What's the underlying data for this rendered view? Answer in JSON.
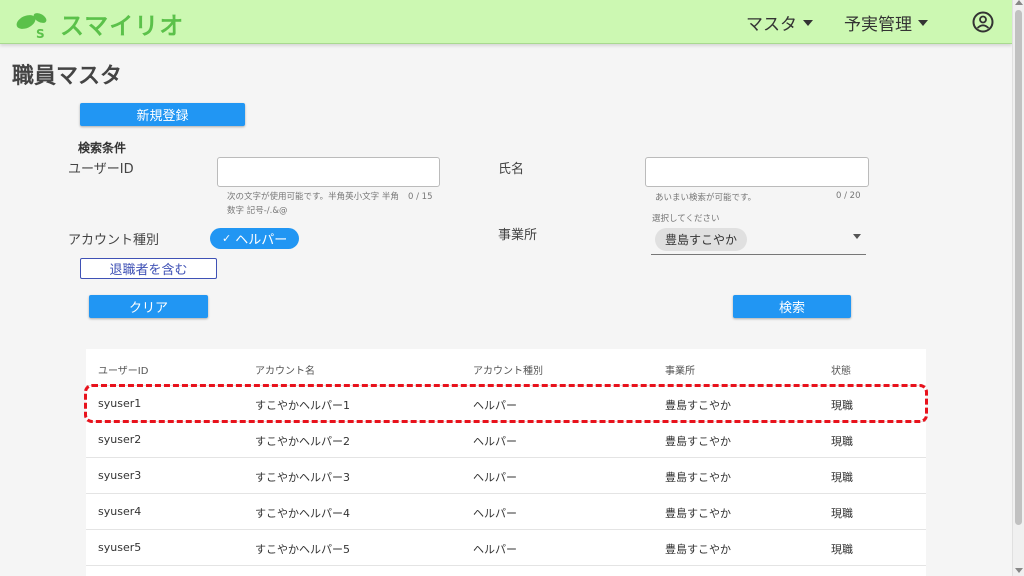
{
  "app": {
    "logo_text": "スマイリオ",
    "menus": [
      {
        "label": "マスタ"
      },
      {
        "label": "予実管理"
      }
    ],
    "colors": {
      "appbar": "#ccf8b2",
      "primary": "#2196f3",
      "highlight": "#e8121c",
      "logo": "#5bc14a"
    }
  },
  "page": {
    "title": "職員マスタ"
  },
  "actions": {
    "new_label": "新規登録",
    "clear_label": "クリア",
    "search_label": "検索"
  },
  "search": {
    "section_title": "検索条件",
    "user_id_label": "ユーザーID",
    "user_id_hint": "次の文字が使用可能です。半角英小文字 半角数字 記号-/.&@",
    "user_id_counter": "0 / 15",
    "name_label": "氏名",
    "name_hint": "あいまい検索が可能です。",
    "name_counter": "0 / 20",
    "account_type_label": "アカウント種別",
    "account_type_chip": "ヘルパー",
    "retired_label": "退職者を含む",
    "office_label": "事業所",
    "office_placeholder": "選択してください",
    "office_selected": "豊島すこやか"
  },
  "table": {
    "headers": [
      "ユーザーID",
      "アカウント名",
      "アカウント種別",
      "事業所",
      "状態"
    ],
    "rows": [
      [
        "syuser1",
        "すこやかヘルパー1",
        "ヘルパー",
        "豊島すこやか",
        "現職"
      ],
      [
        "syuser2",
        "すこやかヘルパー2",
        "ヘルパー",
        "豊島すこやか",
        "現職"
      ],
      [
        "syuser3",
        "すこやかヘルパー3",
        "ヘルパー",
        "豊島すこやか",
        "現職"
      ],
      [
        "syuser4",
        "すこやかヘルパー4",
        "ヘルパー",
        "豊島すこやか",
        "現職"
      ],
      [
        "syuser5",
        "すこやかヘルパー5",
        "ヘルパー",
        "豊島すこやか",
        "現職"
      ]
    ]
  }
}
